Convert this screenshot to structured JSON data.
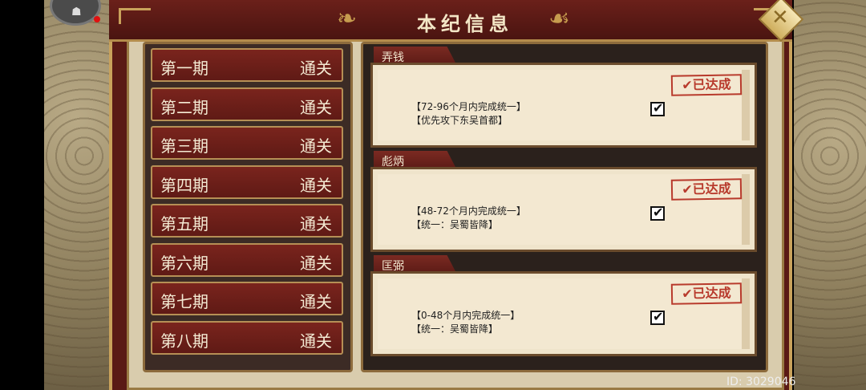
{
  "title": "本纪信息",
  "stages": [
    {
      "name": "第一期",
      "status": "通关"
    },
    {
      "name": "第二期",
      "status": "通关"
    },
    {
      "name": "第三期",
      "status": "通关"
    },
    {
      "name": "第四期",
      "status": "通关"
    },
    {
      "name": "第五期",
      "status": "通关"
    },
    {
      "name": "第六期",
      "status": "通关"
    },
    {
      "name": "第七期",
      "status": "通关"
    },
    {
      "name": "第八期",
      "status": "通关"
    }
  ],
  "cards": [
    {
      "tag": "弄钱",
      "stamp": "✔已达成",
      "lines": [
        "【72-96个月内完成统一】",
        "【优先攻下东吴首都】"
      ],
      "checked": true
    },
    {
      "tag": "彪炳",
      "stamp": "✔已达成",
      "lines": [
        "【48-72个月内完成统一】",
        "【统一：吴蜀皆降】"
      ],
      "checked": true
    },
    {
      "tag": "匡弼",
      "stamp": "✔已达成",
      "lines": [
        "【0-48个月内完成统一】",
        "【统一：吴蜀皆降】"
      ],
      "checked": true
    }
  ],
  "footer": {
    "id": "ID: 3029046"
  },
  "icons": {
    "close": "close-icon",
    "check": "check-icon",
    "avatar": "avatar-icon"
  },
  "colors": {
    "accent": "#c9a25b",
    "panel": "#5f1a15",
    "stamp": "#b83a2c"
  }
}
